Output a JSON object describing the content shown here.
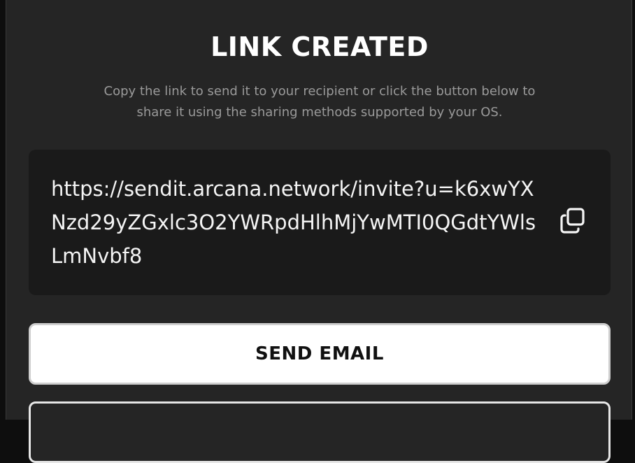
{
  "dialog": {
    "title": "LINK CREATED",
    "subtitle": "Copy the link to send it to your recipient or click the button below to share it using the sharing methods supported by your OS.",
    "link": "https://sendit.arcana.network/invite?u=k6xwYXNzd29yZGxlc3O2YWRpdHlhMjYwMTI0QGdtYWlsLmNvbf8",
    "copy_icon": "copy-icon",
    "send_email_label": "SEND EMAIL"
  }
}
